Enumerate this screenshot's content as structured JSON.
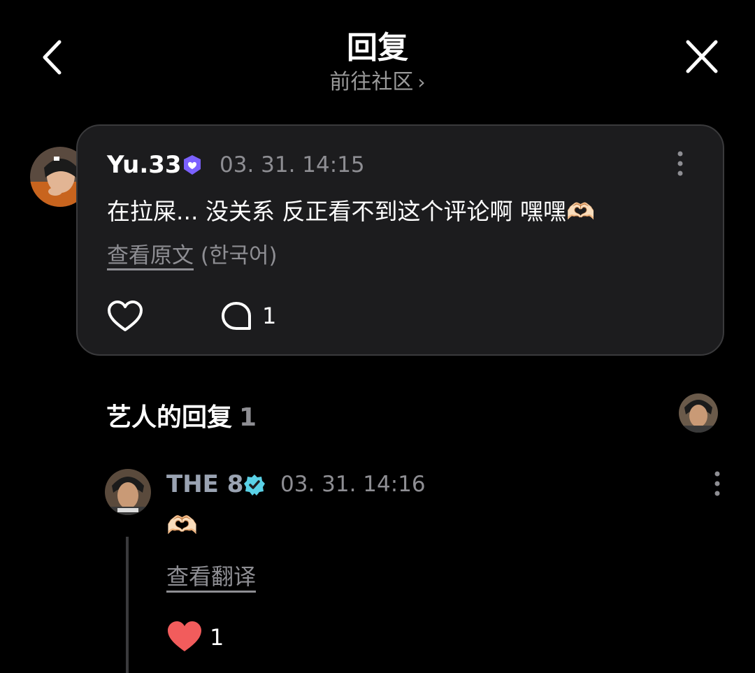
{
  "header": {
    "title": "回复",
    "subtitle": "前往社区",
    "back_icon": "chevron-left-icon",
    "close_icon": "close-icon"
  },
  "comment": {
    "username": "Yu.33",
    "timestamp": "03. 31. 14:15",
    "text": "在拉屎... 没关系 反正看不到这个评论啊 嘿嘿🫶🏻",
    "view_original": "查看原文",
    "original_language": "(한국어)",
    "reply_count": "1",
    "verified_badge_color": "#7b61ff"
  },
  "artist_replies": {
    "title": "艺人的回复",
    "count": "1"
  },
  "reply": {
    "username": "THE 8",
    "timestamp": "03. 31. 14:16",
    "text": "🫶🏻",
    "view_translation": "查看翻译",
    "like_count": "1",
    "verified_badge_color": "#5ad1e6",
    "like_color": "#f25c5c"
  }
}
